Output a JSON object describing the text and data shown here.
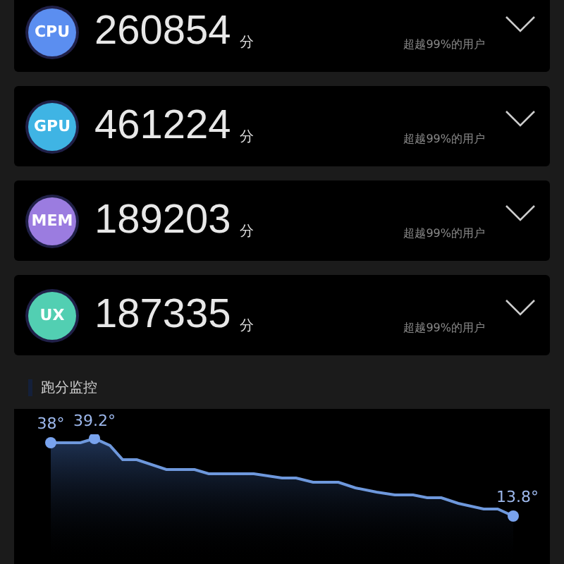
{
  "scores": [
    {
      "badge": "CPU",
      "color": "#5b8ef0",
      "score": "260854",
      "unit": "分",
      "rank": "超越99%的用户"
    },
    {
      "badge": "GPU",
      "color": "#3fb4e4",
      "score": "461224",
      "unit": "分",
      "rank": "超越99%的用户"
    },
    {
      "badge": "MEM",
      "color": "#9b7ce0",
      "score": "189203",
      "unit": "分",
      "rank": "超越99%的用户"
    },
    {
      "badge": "UX",
      "color": "#52cfb2",
      "score": "187335",
      "unit": "分",
      "rank": "超越99%的用户"
    }
  ],
  "monitor": {
    "title": "跑分监控",
    "start_label": "38°",
    "peak_label": "39.2°",
    "end_label": "13.8°"
  }
}
